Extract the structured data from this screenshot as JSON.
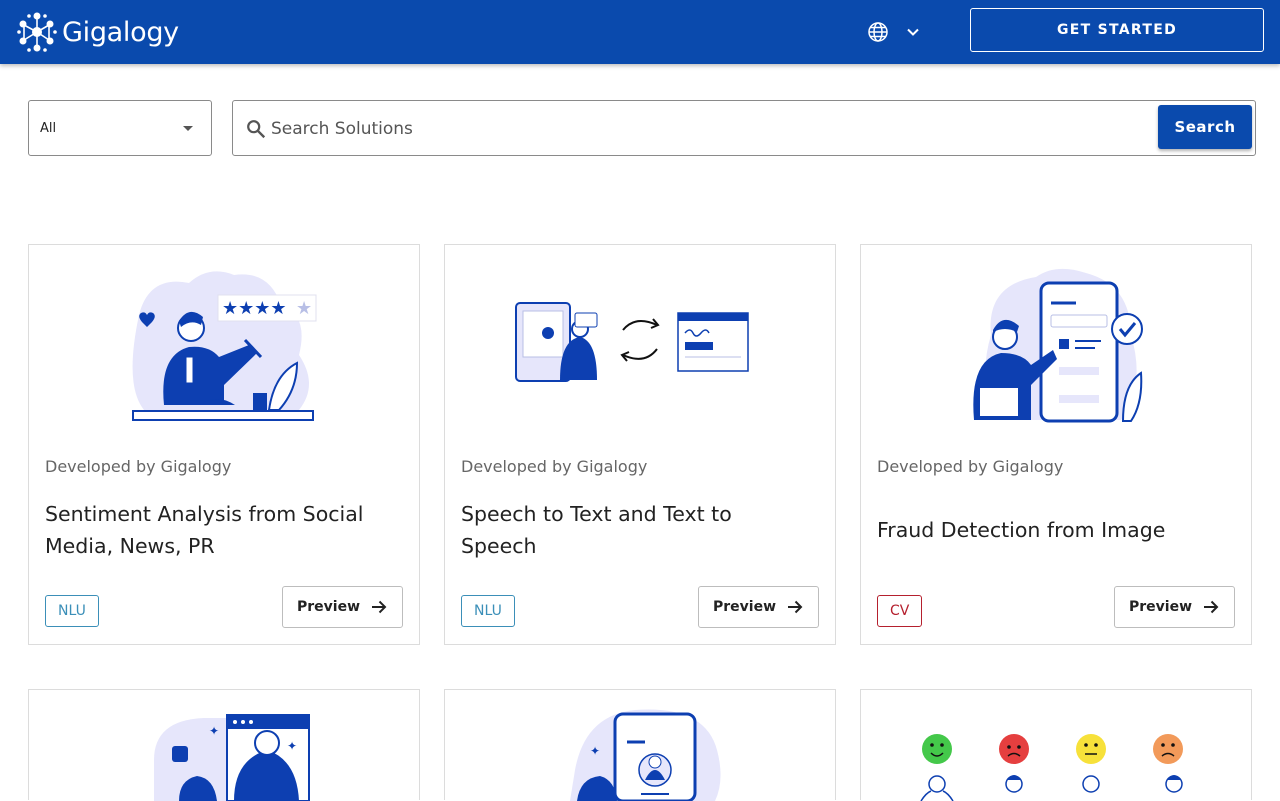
{
  "header": {
    "logo_text": "Gigalogy",
    "language_icon": "globe-icon",
    "cta_label": "GET STARTED"
  },
  "search": {
    "filter_value": "All",
    "placeholder": "Search Solutions",
    "button_label": "Search"
  },
  "cards": [
    {
      "developer": "Developed by Gigalogy",
      "title": "Sentiment Analysis from Social Media, News, PR",
      "tag": "NLU",
      "tag_color": "#3b8fb8",
      "preview_label": "Preview"
    },
    {
      "developer": "Developed by Gigalogy",
      "title": "Speech to Text and Text to Speech",
      "tag": "NLU",
      "tag_color": "#3b8fb8",
      "preview_label": "Preview"
    },
    {
      "developer": "Developed by Gigalogy",
      "title": "Fraud Detection from Image",
      "tag": "CV",
      "tag_color": "#b5202e",
      "preview_label": "Preview"
    }
  ],
  "colors": {
    "brand": "#0a4aad",
    "illustration_blue": "#0d3fb1",
    "illustration_lavender": "#e6e6fb"
  }
}
